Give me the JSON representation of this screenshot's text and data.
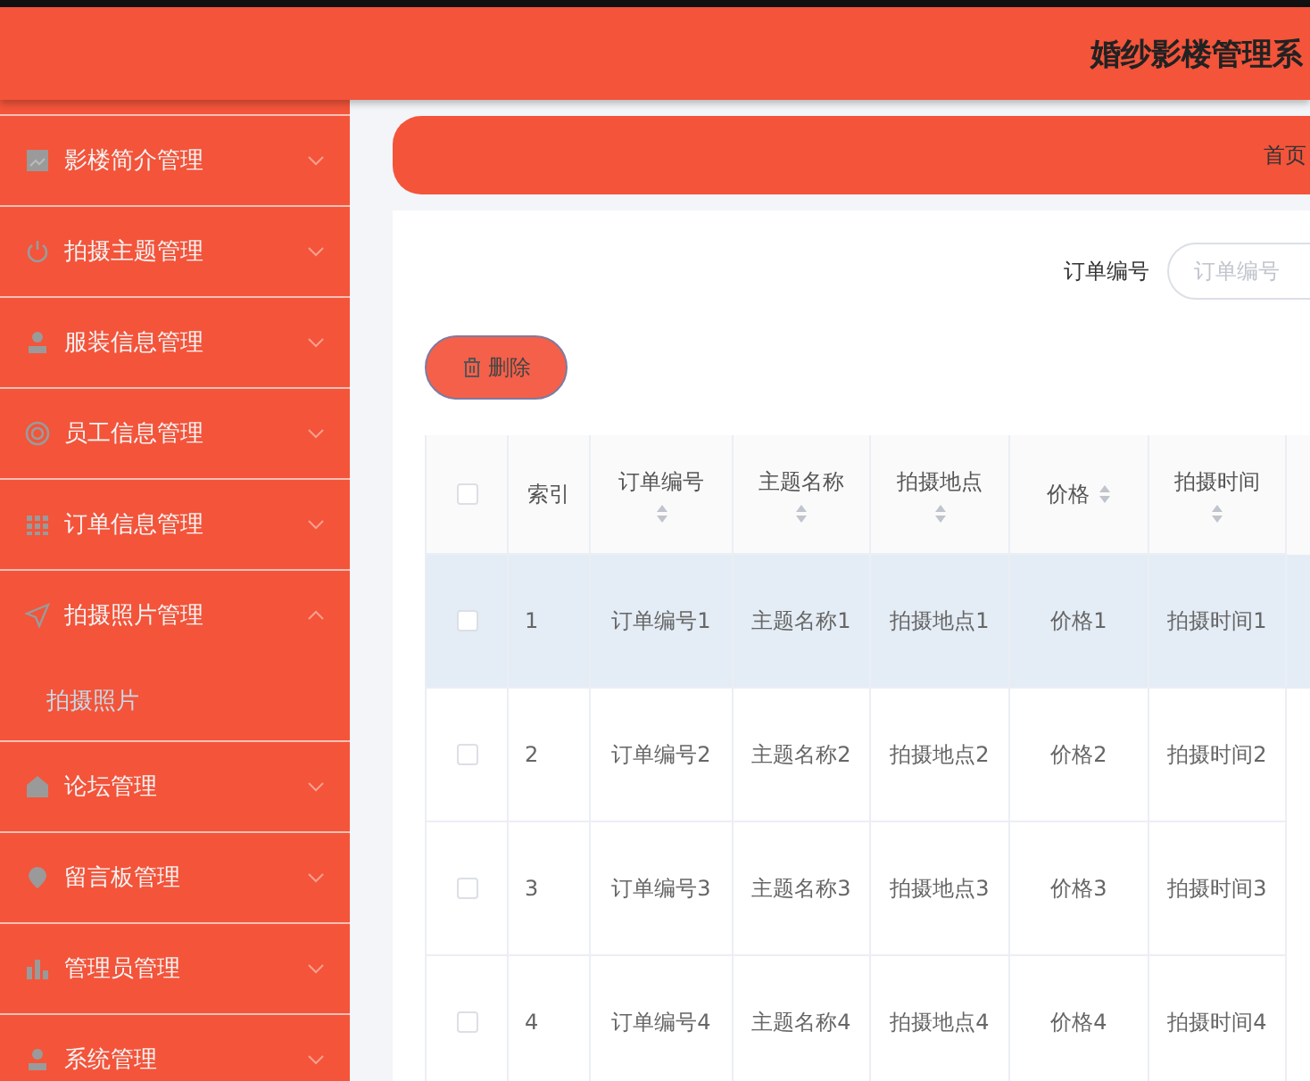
{
  "header": {
    "title": "婚纱影楼管理系"
  },
  "sidebar": {
    "items": [
      {
        "label": "影楼简介管理",
        "kind": "picture",
        "expanded": false
      },
      {
        "label": "拍摄主题管理",
        "kind": "power",
        "expanded": false
      },
      {
        "label": "服装信息管理",
        "kind": "user",
        "expanded": false
      },
      {
        "label": "员工信息管理",
        "kind": "target",
        "expanded": false
      },
      {
        "label": "订单信息管理",
        "kind": "grid",
        "expanded": false
      },
      {
        "label": "拍摄照片管理",
        "kind": "send",
        "expanded": true,
        "children": [
          {
            "label": "拍摄照片"
          }
        ]
      },
      {
        "label": "论坛管理",
        "kind": "house",
        "expanded": false
      },
      {
        "label": "留言板管理",
        "kind": "pin",
        "expanded": false
      },
      {
        "label": "管理员管理",
        "kind": "bars",
        "expanded": false
      },
      {
        "label": "系统管理",
        "kind": "user",
        "expanded": false
      }
    ]
  },
  "breadcrumb": [
    "首页"
  ],
  "search": {
    "label": "订单编号",
    "placeholder": "订单编号"
  },
  "delete_button": "删除",
  "table": {
    "columns": [
      {
        "label": "索引",
        "sortable": false
      },
      {
        "label": "订单编号",
        "sortable": true
      },
      {
        "label": "主题名称",
        "sortable": true
      },
      {
        "label": "拍摄地点",
        "sortable": true
      },
      {
        "label": "价格",
        "sortable": true
      },
      {
        "label": "拍摄时间",
        "sortable": true
      }
    ],
    "all_checked": false,
    "rows": [
      {
        "checked": false,
        "hovered": true,
        "cells": [
          "1",
          "订单编号1",
          "主题名称1",
          "拍摄地点1",
          "价格1",
          "拍摄时间1"
        ]
      },
      {
        "checked": false,
        "hovered": false,
        "cells": [
          "2",
          "订单编号2",
          "主题名称2",
          "拍摄地点2",
          "价格2",
          "拍摄时间2"
        ]
      },
      {
        "checked": false,
        "hovered": false,
        "cells": [
          "3",
          "订单编号3",
          "主题名称3",
          "拍摄地点3",
          "价格3",
          "拍摄时间3"
        ]
      },
      {
        "checked": false,
        "hovered": false,
        "cells": [
          "4",
          "订单编号4",
          "主题名称4",
          "拍摄地点4",
          "价格4",
          "拍摄时间4"
        ]
      }
    ]
  }
}
